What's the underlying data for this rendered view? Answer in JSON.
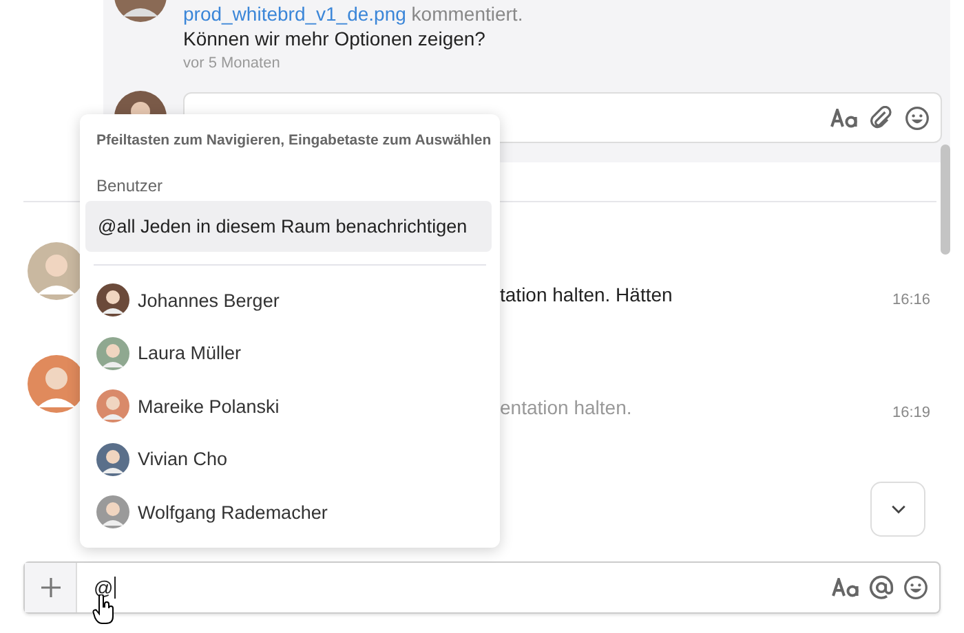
{
  "comment": {
    "file": "prod_whitebrd_v1_de.png",
    "action": "kommentiert.",
    "text": "Können wir mehr Optionen zeigen?",
    "time": "vor 5 Monaten"
  },
  "mention_popup": {
    "hint": "Pfeiltasten zum Navigieren, Eingabetaste zum Auswählen",
    "section": "Benutzer",
    "all": {
      "handle": "@all",
      "label": "Jeden in diesem Raum benachrichtigen",
      "selected": true
    },
    "users": [
      {
        "name": "Johannes Berger",
        "selected": false,
        "color": "#6b4a3a"
      },
      {
        "name": "Laura Müller",
        "selected": false,
        "color": "#8fa890"
      },
      {
        "name": "Mareike Polanski",
        "selected": false,
        "color": "#d98a6a"
      },
      {
        "name": "Vivian Cho",
        "selected": false,
        "color": "#5a6f8a"
      },
      {
        "name": "Wolfgang Rademacher",
        "selected": false,
        "color": "#9a9a9a"
      }
    ]
  },
  "messages": [
    {
      "text": "tation halten. Hätten",
      "time": "16:16",
      "muted": false
    },
    {
      "text": "entation halten.",
      "time": "16:19",
      "muted": true
    }
  ],
  "composer": {
    "value": "@"
  }
}
